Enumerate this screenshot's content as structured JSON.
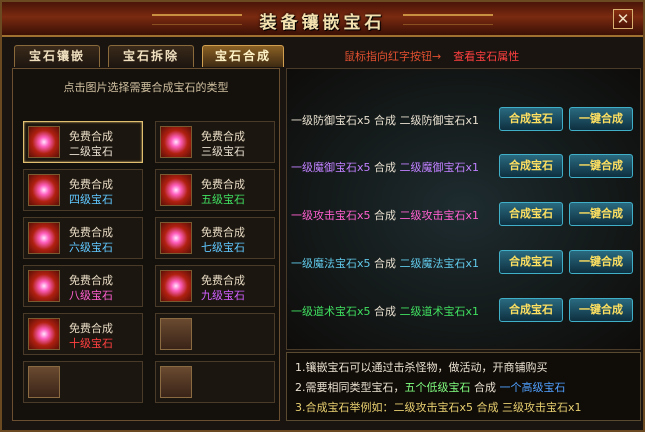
{
  "window": {
    "title": "装备镶嵌宝石",
    "close_glyph": "✕"
  },
  "tabs": [
    {
      "label": "宝石镶嵌",
      "active": false
    },
    {
      "label": "宝石拆除",
      "active": false
    },
    {
      "label": "宝石合成",
      "active": true
    }
  ],
  "hint": {
    "text": "鼠标指向红字按钮→",
    "link": "查看宝石属性"
  },
  "left": {
    "instruction": "点击图片选择需要合成宝石的类型",
    "slots": [
      {
        "line1": "免费合成",
        "line2": "二级宝石",
        "color": "#e8e0d0",
        "selected": true
      },
      {
        "line1": "免费合成",
        "line2": "三级宝石",
        "color": "#e8e0d0"
      },
      {
        "line1": "免费合成",
        "line2": "四级宝石",
        "color": "#60c8ff"
      },
      {
        "line1": "免费合成",
        "line2": "五级宝石",
        "color": "#40e060"
      },
      {
        "line1": "免费合成",
        "line2": "六级宝石",
        "color": "#60c8ff"
      },
      {
        "line1": "免费合成",
        "line2": "七级宝石",
        "color": "#60c8ff"
      },
      {
        "line1": "免费合成",
        "line2": "八级宝石",
        "color": "#ff60d0"
      },
      {
        "line1": "免费合成",
        "line2": "九级宝石",
        "color": "#d060ff"
      },
      {
        "line1": "免费合成",
        "line2": "十级宝石",
        "color": "#ff4040"
      }
    ]
  },
  "recipes": [
    {
      "src": "一级防御宝石x5",
      "op": "合成",
      "dst": "二级防御宝石x1",
      "color": "#e8e0d0",
      "btn1": "合成宝石",
      "btn2": "一键合成"
    },
    {
      "src": "一级魔御宝石x5",
      "op": "合成",
      "dst": "二级魔御宝石x1",
      "color": "#c080ff",
      "btn1": "合成宝石",
      "btn2": "一键合成"
    },
    {
      "src": "一级攻击宝石x5",
      "op": "合成",
      "dst": "二级攻击宝石x1",
      "color": "#ff60d0",
      "btn1": "合成宝石",
      "btn2": "一键合成"
    },
    {
      "src": "一级魔法宝石x5",
      "op": "合成",
      "dst": "二级魔法宝石x1",
      "color": "#60c8e8",
      "btn1": "合成宝石",
      "btn2": "一键合成"
    },
    {
      "src": "一级道术宝石x5",
      "op": "合成",
      "dst": "二级道术宝石x1",
      "color": "#40e060",
      "btn1": "合成宝石",
      "btn2": "一键合成"
    }
  ],
  "notes": {
    "n1": "1.镶嵌宝石可以通过击杀怪物，做活动，开商铺购买",
    "n2a": "2.需要相同类型宝石，",
    "n2b": "五个低级宝石",
    "n2c": "合成",
    "n2d": "一个高级宝石",
    "n3": "3.合成宝石举例如：二级攻击宝石x5 合成 三级攻击宝石x1"
  }
}
